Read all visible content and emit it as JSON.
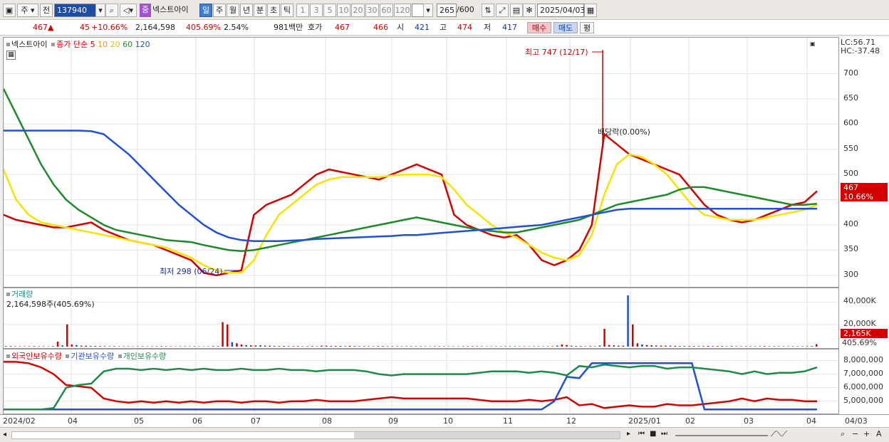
{
  "toolbar": {
    "market": "주",
    "prefix": "전",
    "code": "137940",
    "badge": "중",
    "stock_name": "넥스트아이",
    "periods": [
      "일",
      "주",
      "월",
      "년",
      "분",
      "초",
      "틱"
    ],
    "intervals": [
      "1",
      "3",
      "5",
      "10",
      "20",
      "30",
      "60",
      "120"
    ],
    "count": "265",
    "count_max": "/600",
    "date": "2025/04/03"
  },
  "quote": {
    "price": "467",
    "up_mark": "▲",
    "change": "45",
    "change_pct": "+10.66%",
    "volume": "2,164,598",
    "vol_ratio": "405.69%",
    "turnover": "2.54%",
    "amount": "981백만",
    "hoga_label": "호가",
    "ask": "467",
    "bid": "466",
    "open_label": "시",
    "open": "421",
    "high_label": "고",
    "high": "474",
    "low_label": "저",
    "low": "417",
    "buy_label": "매수",
    "sell_label": "매도",
    "eval_label": "평"
  },
  "price_panel": {
    "legend_name": "넥스트아이",
    "legend_ma": "종가 단순",
    "ma_periods": [
      "5",
      "10",
      "20",
      "60",
      "120"
    ],
    "ma_colors": [
      "#d40000",
      "#ff8c00",
      "#f5e400",
      "#1f8a2a",
      "#1f50d6"
    ],
    "lc": "LC:56.71",
    "hc": "HC:-37.48",
    "high_note": "최고 747 (12/17)",
    "low_note": "최저 298 (06/24)",
    "dividend_note": "배당락(0.00%)",
    "price_tag": "467",
    "pct_tag": "10.66%"
  },
  "volume_panel": {
    "title": "거래량",
    "value": "2,164,598주(405.69%)",
    "tag": "2,165K",
    "tag_pct": "405.69%"
  },
  "holding_panel": {
    "legend": [
      "외국인보유수량",
      "기관보유수량",
      "개인보유수량"
    ],
    "colors": [
      "#d40000",
      "#1f50d6",
      "#1f8a4a"
    ]
  },
  "x_labels": [
    "2024/02",
    "04",
    "05",
    "06",
    "07",
    "08",
    "09",
    "10",
    "11",
    "12",
    "2025/01",
    "02",
    "03",
    "04",
    "04/03"
  ],
  "chart_data": [
    {
      "type": "line",
      "title": "",
      "ylim": [
        280,
        760
      ],
      "y_ticks": [
        300,
        350,
        400,
        450,
        500,
        550,
        600,
        650,
        700
      ],
      "candle_color_up": "#d40000",
      "candle_color_down": "#1f50d6",
      "high": {
        "value": 747,
        "date": "12/17"
      },
      "low": {
        "value": 298,
        "date": "06/24"
      },
      "series": [
        {
          "name": "5",
          "color": "#d40000",
          "values": [
            420,
            410,
            405,
            400,
            395,
            395,
            400,
            405,
            390,
            380,
            370,
            365,
            360,
            350,
            340,
            330,
            305,
            300,
            305,
            310,
            420,
            440,
            450,
            460,
            480,
            500,
            510,
            505,
            500,
            495,
            490,
            500,
            510,
            520,
            510,
            500,
            420,
            400,
            390,
            380,
            375,
            380,
            360,
            330,
            320,
            330,
            350,
            400,
            580,
            560,
            540,
            530,
            520,
            510,
            500,
            470,
            440,
            420,
            410,
            405,
            410,
            420,
            430,
            440,
            445,
            467
          ]
        },
        {
          "name": "20",
          "color": "#f5e400",
          "values": [
            510,
            450,
            420,
            405,
            400,
            395,
            390,
            385,
            380,
            375,
            370,
            365,
            360,
            355,
            345,
            335,
            320,
            310,
            305,
            305,
            330,
            380,
            420,
            440,
            460,
            480,
            490,
            495,
            495,
            495,
            495,
            498,
            500,
            500,
            500,
            495,
            470,
            440,
            420,
            400,
            385,
            375,
            360,
            345,
            335,
            330,
            340,
            380,
            460,
            520,
            540,
            535,
            520,
            500,
            470,
            440,
            420,
            415,
            410,
            410,
            410,
            415,
            420,
            425,
            430,
            440
          ]
        },
        {
          "name": "60",
          "color": "#1f8a2a",
          "values": [
            670,
            620,
            570,
            520,
            480,
            450,
            430,
            415,
            400,
            390,
            385,
            380,
            375,
            370,
            368,
            366,
            360,
            355,
            350,
            348,
            350,
            355,
            360,
            365,
            370,
            375,
            380,
            385,
            390,
            395,
            400,
            405,
            410,
            415,
            410,
            405,
            400,
            395,
            390,
            388,
            385,
            385,
            390,
            395,
            400,
            405,
            410,
            420,
            430,
            440,
            445,
            450,
            455,
            460,
            470,
            475,
            475,
            470,
            465,
            460,
            455,
            450,
            445,
            440,
            440,
            442
          ]
        },
        {
          "name": "120",
          "color": "#1f50d6",
          "values": [
            587,
            587,
            587,
            587,
            587,
            587,
            587,
            586,
            580,
            560,
            540,
            515,
            490,
            465,
            440,
            420,
            400,
            385,
            375,
            370,
            368,
            368,
            368,
            369,
            370,
            372,
            373,
            374,
            375,
            376,
            377,
            378,
            380,
            380,
            382,
            384,
            386,
            388,
            390,
            392,
            394,
            396,
            398,
            400,
            405,
            410,
            415,
            420,
            425,
            430,
            432,
            432,
            432,
            432,
            432,
            432,
            432,
            432,
            432,
            432,
            432,
            432,
            432,
            432,
            432,
            432
          ]
        }
      ]
    },
    {
      "type": "bar",
      "title": "거래량",
      "ylim": [
        0,
        46000
      ],
      "y_ticks": [
        20000,
        40000
      ],
      "values": [
        600,
        500,
        400,
        400,
        300,
        400,
        500,
        400,
        300,
        300,
        500,
        4500,
        1200,
        20000,
        2000,
        1500,
        900,
        800,
        700,
        600,
        500,
        500,
        400,
        400,
        400,
        300,
        300,
        300,
        300,
        400,
        300,
        300,
        300,
        500,
        400,
        300,
        300,
        300,
        300,
        300,
        400,
        300,
        300,
        300,
        500,
        500,
        22000,
        20000,
        4000,
        3000,
        2000,
        1500,
        1200,
        1000,
        1200,
        900,
        800,
        700,
        600,
        600,
        500,
        500,
        500,
        400,
        400,
        500,
        400,
        900,
        800,
        700,
        600,
        600,
        500,
        700,
        500,
        500,
        400,
        400,
        400,
        500,
        500,
        400,
        400,
        400,
        400,
        400,
        400,
        400,
        400,
        300,
        300,
        400,
        400,
        400,
        300,
        300,
        300,
        400,
        400,
        500,
        400,
        400,
        300,
        300,
        300,
        400,
        400,
        300,
        400,
        300,
        300,
        300,
        300,
        300,
        300,
        400,
        400,
        1000,
        2000,
        1500,
        800,
        600,
        500,
        400,
        500,
        400,
        1000,
        16000,
        1500,
        1200,
        900,
        800,
        46000,
        20000,
        3000,
        2000,
        1500,
        1200,
        1000,
        900,
        800,
        800,
        700,
        600,
        600,
        500,
        500,
        500,
        500,
        700,
        600,
        500,
        500,
        400,
        500,
        400,
        400,
        400,
        400,
        400,
        400,
        500,
        400,
        400,
        400,
        400,
        400,
        400,
        400,
        400,
        400,
        600,
        2165
      ]
    },
    {
      "type": "line",
      "title": "",
      "ylim": [
        4200000,
        8500000
      ],
      "y_ticks": [
        5000000,
        6000000,
        7000000,
        8000000
      ],
      "series": [
        {
          "name": "외국인보유수량",
          "color": "#d40000",
          "values": [
            7900,
            7900,
            7800,
            7500,
            7000,
            6200,
            6100,
            6000,
            5200,
            5000,
            4900,
            5000,
            4900,
            5000,
            4900,
            5000,
            4900,
            5000,
            5000,
            4900,
            5000,
            5000,
            4900,
            5000,
            5000,
            5100,
            5000,
            5000,
            5000,
            5100,
            5200,
            5300,
            5200,
            5200,
            5200,
            5200,
            5200,
            5200,
            5100,
            5000,
            5000,
            5000,
            5100,
            5000,
            5100,
            5300,
            4700,
            4800,
            4500,
            4600,
            4700,
            4600,
            4600,
            4800,
            4700,
            4700,
            4800,
            4900,
            5000,
            5200,
            5000,
            5200,
            5100,
            5100,
            5000,
            5000
          ]
        },
        {
          "name": "기관보유수량",
          "color": "#1f50d6",
          "values": [
            4400,
            4400,
            4400,
            4400,
            4400,
            4400,
            4400,
            4400,
            4400,
            4400,
            4400,
            4400,
            4400,
            4400,
            4400,
            4400,
            4400,
            4400,
            4400,
            4400,
            4400,
            4400,
            4400,
            4400,
            4400,
            4400,
            4400,
            4400,
            4400,
            4400,
            4400,
            4400,
            4400,
            4400,
            4400,
            4400,
            4400,
            4400,
            4400,
            4400,
            4400,
            4400,
            4400,
            4400,
            5000,
            6800,
            6700,
            7800,
            7800,
            7800,
            7800,
            7800,
            7800,
            7800,
            7800,
            7800,
            4400,
            4400,
            4400,
            4400,
            4400,
            4400,
            4400,
            4400,
            4400,
            4400
          ]
        },
        {
          "name": "개인보유수량",
          "color": "#1f8a4a",
          "values": [
            4400,
            4400,
            4400,
            4400,
            4500,
            6000,
            6200,
            6300,
            7200,
            7400,
            7400,
            7300,
            7400,
            7300,
            7400,
            7300,
            7400,
            7300,
            7300,
            7400,
            7300,
            7300,
            7400,
            7300,
            7300,
            7200,
            7300,
            7300,
            7300,
            7200,
            7000,
            6900,
            7000,
            7000,
            7000,
            7000,
            7000,
            7000,
            7100,
            7200,
            7200,
            7200,
            7100,
            7200,
            7100,
            6900,
            7600,
            7500,
            7700,
            7600,
            7500,
            7600,
            7600,
            7400,
            7500,
            7500,
            7400,
            7300,
            7200,
            7000,
            7200,
            7000,
            7100,
            7100,
            7200,
            7500
          ]
        }
      ]
    }
  ]
}
